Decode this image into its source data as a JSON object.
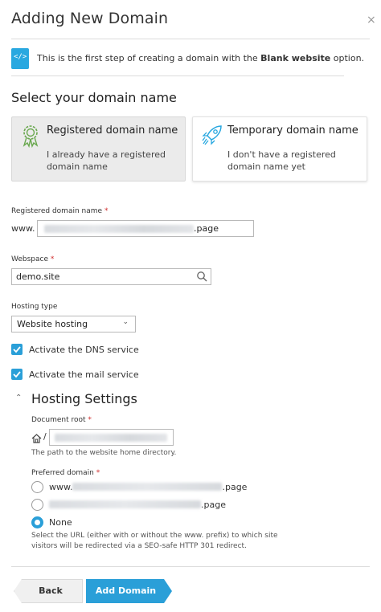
{
  "dialog": {
    "title": "Adding New Domain",
    "close_glyph": "×"
  },
  "info": {
    "prefix": "This is the first step of creating a domain with the ",
    "bold": "Blank website",
    "suffix": " option.",
    "icon": "code-icon"
  },
  "section_title": "Select your domain name",
  "cards": [
    {
      "title": "Registered domain name",
      "desc": "I already have a registered domain name",
      "icon": "badge-icon",
      "selected": true
    },
    {
      "title": "Temporary domain name",
      "desc": "I don't have a registered domain name yet",
      "icon": "rocket-icon",
      "selected": false
    }
  ],
  "registered_domain": {
    "label": "Registered domain name",
    "required_mark": "*",
    "prefix": "www.",
    "suffix": ".page"
  },
  "webspace": {
    "label": "Webspace",
    "required_mark": "*",
    "value": "demo.site",
    "icon": "search-icon"
  },
  "hosting_type": {
    "label": "Hosting type",
    "value": "Website hosting",
    "icon": "chevron-down-icon"
  },
  "checkboxes": [
    {
      "label": "Activate the DNS service",
      "checked": true
    },
    {
      "label": "Activate the mail service",
      "checked": true
    }
  ],
  "hosting_settings": {
    "title": "Hosting Settings",
    "doc_root": {
      "label": "Document root",
      "required_mark": "*",
      "prefix": "/",
      "icon": "home-icon",
      "hint": "The path to the website home directory."
    },
    "preferred_domain": {
      "label": "Preferred domain",
      "required_mark": "*",
      "options": [
        {
          "prefix": "www.",
          "suffix": ".page",
          "selected": false
        },
        {
          "prefix": "",
          "suffix": ".page",
          "selected": false
        },
        {
          "prefix": "None",
          "suffix": "",
          "selected": true
        }
      ],
      "hint_line1": "Select the URL (either with or without the www. prefix) to which site",
      "hint_line2": "visitors will be redirected via a SEO-safe HTTP 301 redirect."
    }
  },
  "buttons": {
    "back": "Back",
    "add": "Add Domain"
  },
  "colors": {
    "accent": "#2a9fd8",
    "required": "#d02d2d",
    "selected_card": "#ebebeb"
  }
}
